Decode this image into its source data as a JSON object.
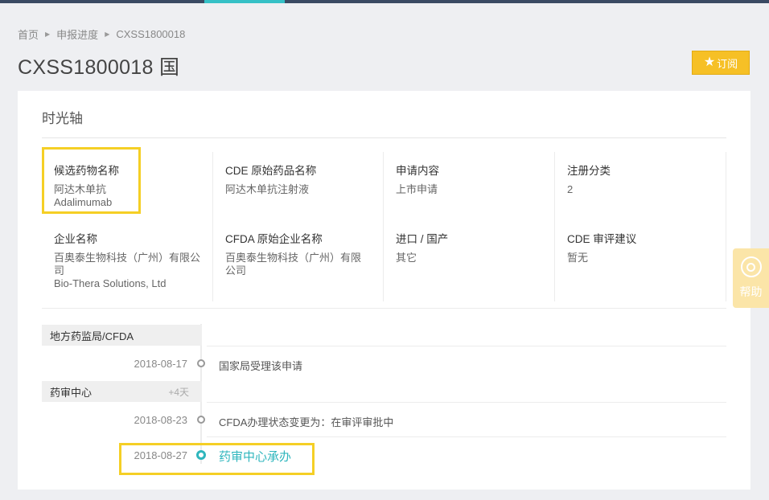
{
  "breadcrumb": {
    "home": "首页",
    "progress": "申报进度",
    "current": "CXSS1800018"
  },
  "header": {
    "title": "CXSS1800018 国",
    "subscribe_label": "订阅"
  },
  "help": {
    "label": "帮助"
  },
  "card": {
    "title": "时光轴",
    "info": {
      "candidate": {
        "label": "候选药物名称",
        "value1": "阿达木单抗",
        "value2": "Adalimumab"
      },
      "cde_drug": {
        "label": "CDE 原始药品名称",
        "value": "阿达木单抗注射液"
      },
      "apply_content": {
        "label": "申请内容",
        "value": "上市申请"
      },
      "reg_class": {
        "label": "注册分类",
        "value": "2"
      },
      "company": {
        "label": "企业名称",
        "value1": "百奥泰生物科技（广州）有限公",
        "value1b": "司",
        "value2": "Bio-Thera Solutions, Ltd"
      },
      "cfda_company": {
        "label": "CFDA 原始企业名称",
        "value1": "百奥泰生物科技（广州）有限",
        "value2": "公司"
      },
      "import": {
        "label": "进口 / 国产",
        "value": "其它"
      },
      "cde_advice": {
        "label": "CDE 审评建议",
        "value": "暂无"
      }
    },
    "timeline": {
      "phases": [
        {
          "name": "地方药监局/CFDA",
          "duration": ""
        },
        {
          "name": "药审中心",
          "duration": "+4天"
        }
      ],
      "events": [
        {
          "date": "2018-08-17",
          "text": "国家局受理该申请"
        },
        {
          "date": "2018-08-23",
          "text": "CFDA办理状态变更为：在审评审批中"
        },
        {
          "date": "2018-08-27",
          "text": "药审中心承办"
        }
      ]
    }
  },
  "colors": {
    "accent": "#2fb6bd",
    "highlight": "#f5cf25",
    "subscribe": "#f6c026",
    "topbar": "#3a4a63"
  }
}
